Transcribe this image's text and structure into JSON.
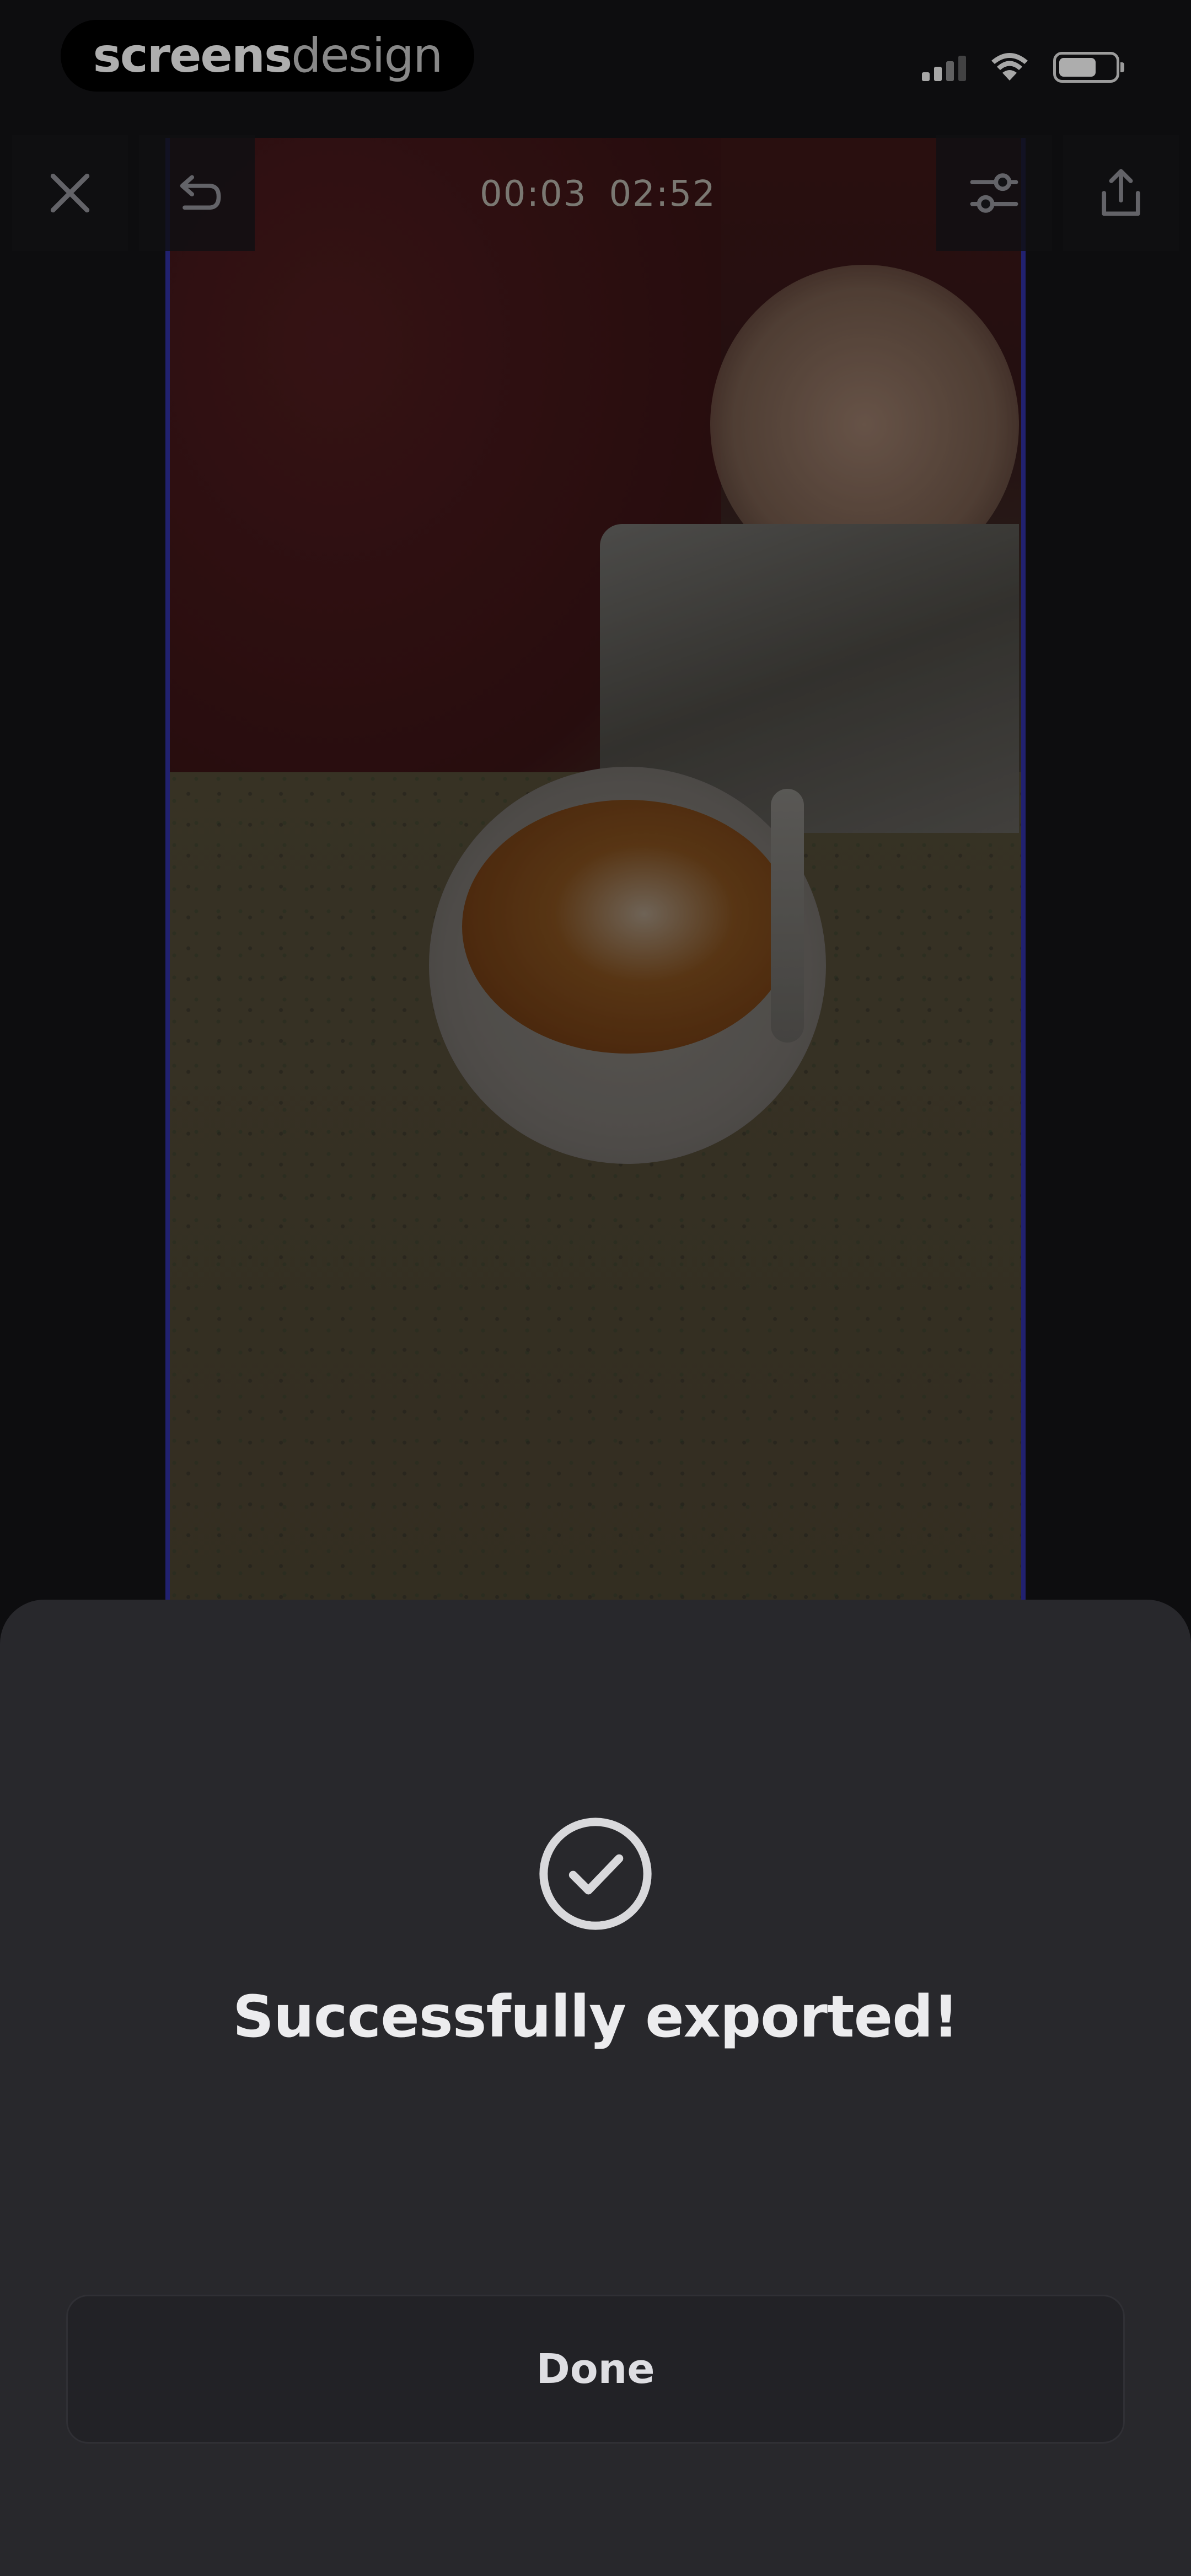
{
  "status_bar": {
    "watermark_part1": "screens",
    "watermark_part2": "design",
    "icons": [
      "signal-icon",
      "wifi-icon",
      "battery-icon"
    ]
  },
  "editor": {
    "timecode_current": "00:03",
    "timecode_total": "02:52",
    "toolbar_icons": [
      "close-icon",
      "undo-icon",
      "adjustments-icon",
      "share-icon"
    ]
  },
  "export_sheet": {
    "icon": "check-circle-icon",
    "title": "Successfully exported!",
    "done_label": "Done"
  },
  "colors": {
    "background": "#121215",
    "sheet": "#28282c",
    "accent_border": "#2f2f9a",
    "text": "#ececee"
  }
}
